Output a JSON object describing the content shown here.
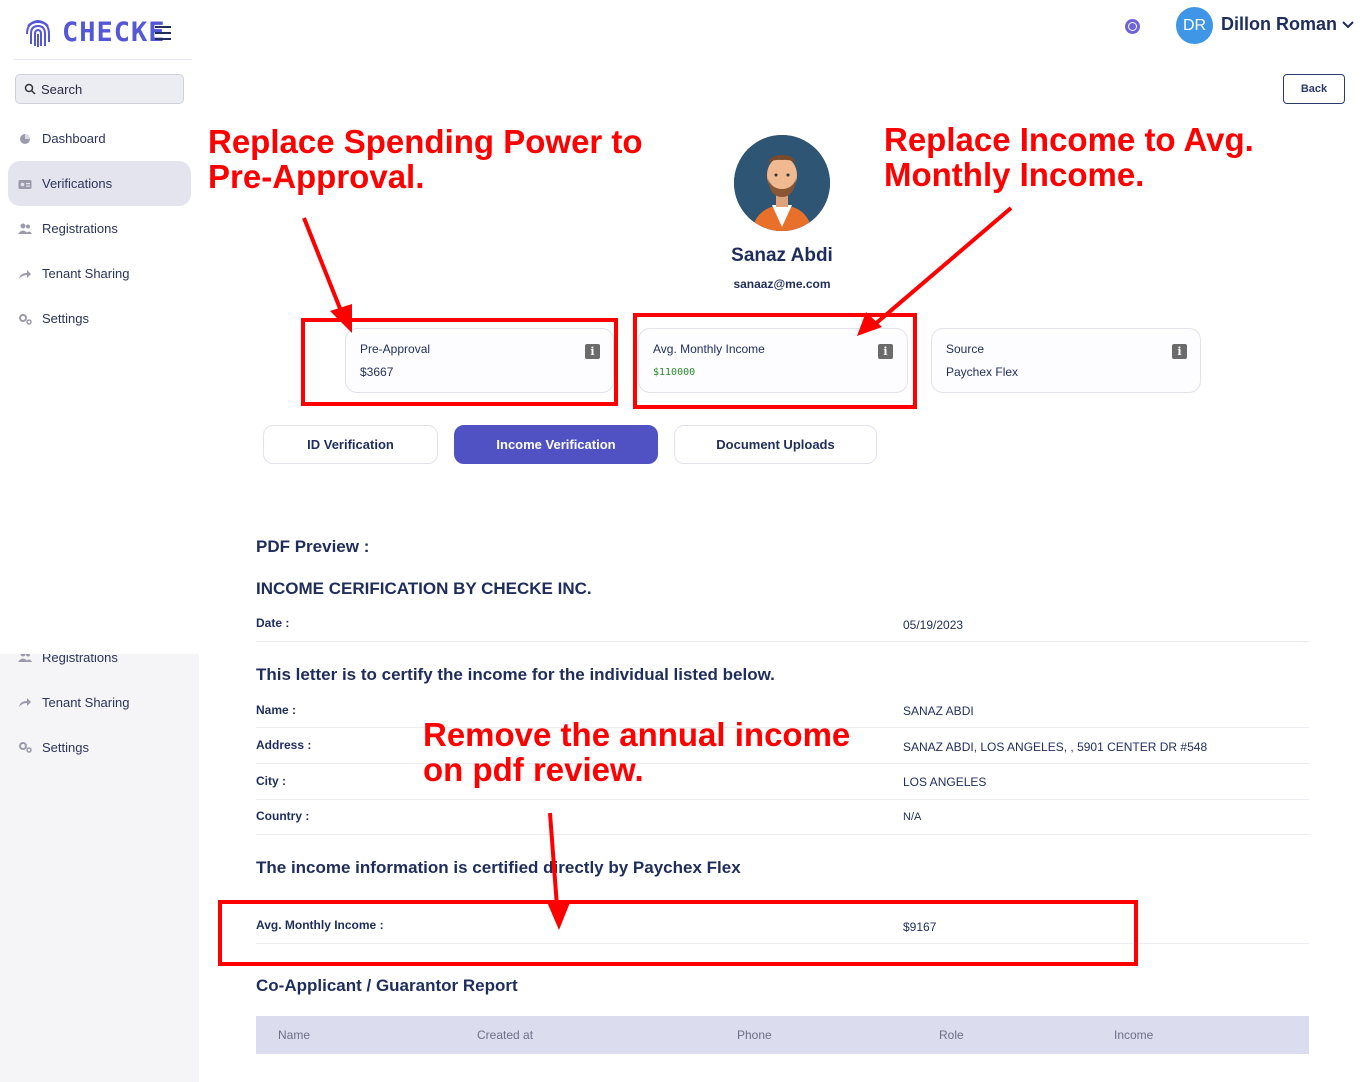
{
  "app": {
    "logo_text": "CHECKE"
  },
  "user": {
    "initials": "DR",
    "name": "Dillon Roman"
  },
  "sidebar": {
    "search_placeholder": "Search",
    "items": [
      {
        "label": "Dashboard",
        "icon": "pie-chart-icon"
      },
      {
        "label": "Verifications",
        "icon": "id-card-icon",
        "active": true
      },
      {
        "label": "Registrations",
        "icon": "users-icon"
      },
      {
        "label": "Tenant Sharing",
        "icon": "share-icon"
      },
      {
        "label": "Settings",
        "icon": "gears-icon"
      }
    ],
    "ghost_items": [
      {
        "label": "Registrations"
      },
      {
        "label": "Tenant Sharing"
      },
      {
        "label": "Settings"
      }
    ]
  },
  "header": {
    "back_label": "Back"
  },
  "profile": {
    "name": "Sanaz Abdi",
    "email": "sanaaz@me.com"
  },
  "stats": [
    {
      "label": "Pre-Approval",
      "value": "$3667"
    },
    {
      "label": "Avg. Monthly Income",
      "value": "$110000"
    },
    {
      "label": "Source",
      "value": "Paychex Flex"
    }
  ],
  "tabs": [
    {
      "label": "ID Verification"
    },
    {
      "label": "Income Verification",
      "active": true
    },
    {
      "label": "Document Uploads"
    }
  ],
  "pdf": {
    "preview_title": "PDF Preview :",
    "cert_title": "INCOME CERIFICATION BY CHECKE INC.",
    "date_label": "Date :",
    "date_value": "05/19/2023",
    "letter_title": "This letter is to certify the income for the individual listed below.",
    "name_label": "Name :",
    "name_value": "SANAZ ABDI",
    "address_label": "Address :",
    "address_value": "SANAZ ABDI, LOS ANGELES, , 5901 CENTER DR #548",
    "city_label": "City :",
    "city_value": "LOS ANGELES",
    "country_label": "Country :",
    "country_value": "N/A",
    "certified_title": "The income information is certified directly by Paychex Flex",
    "income_label": "Avg. Monthly Income :",
    "income_value": "$9167",
    "coapplicant_title": "Co-Applicant / Guarantor Report",
    "table_headers": [
      "Name",
      "Created at",
      "Phone",
      "Role",
      "Income"
    ]
  },
  "annotations": {
    "spending_power": "Replace Spending Power to Pre-Approval.",
    "income": "Replace Income to Avg. Monthly Income.",
    "annual_income": "Remove the annual income on pdf review."
  },
  "colors": {
    "brand": "#5558d6",
    "active_tab": "#5052c4",
    "annotation": "#ff0000",
    "navy_text": "#1f2d5c"
  }
}
